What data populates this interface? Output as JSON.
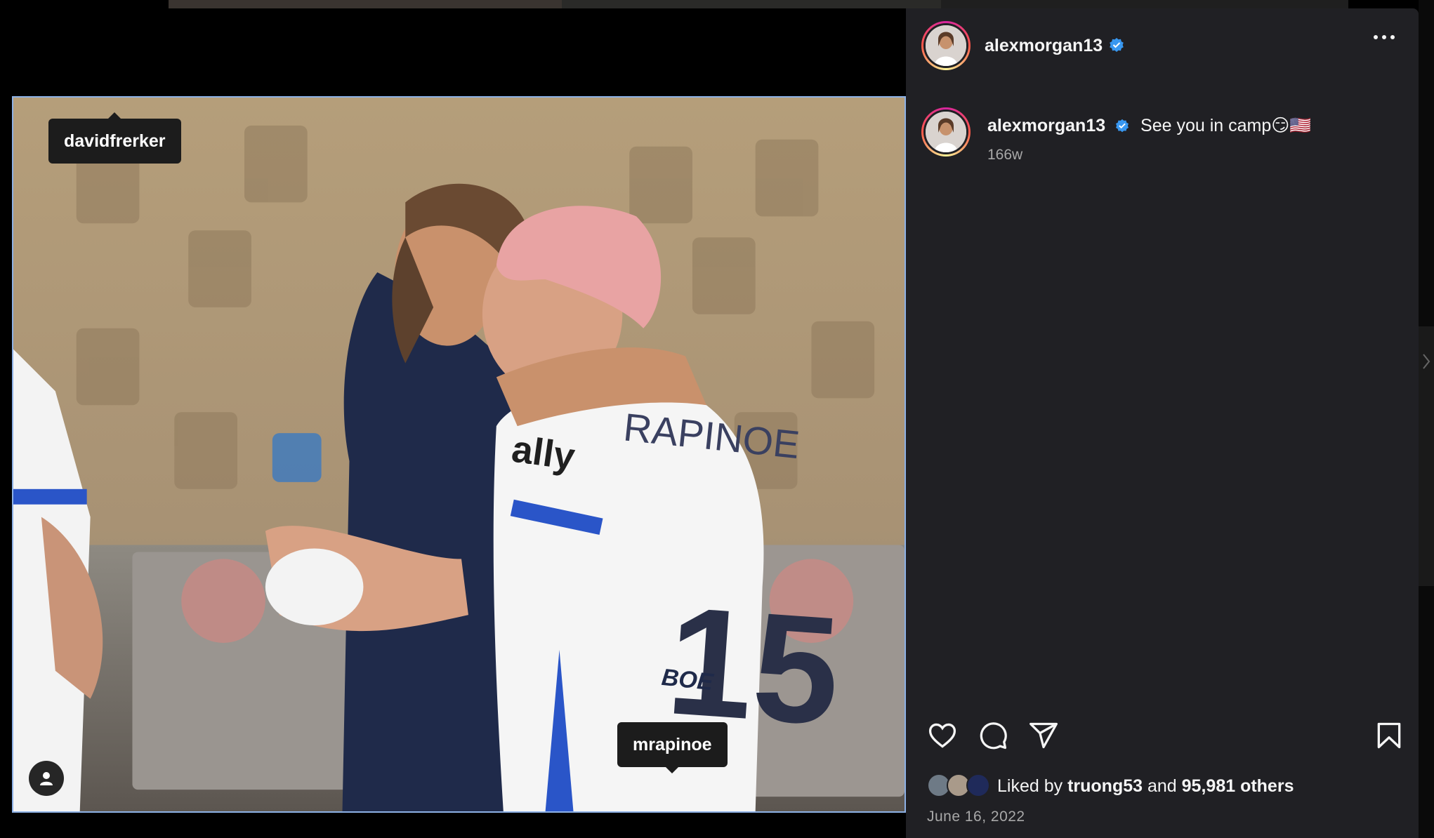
{
  "post": {
    "username": "alexmorgan13",
    "caption_text": "See you in camp😏🇺🇸",
    "age": "166w",
    "liked_prefix": "Liked by",
    "liked_user": "truong53",
    "liked_and": "and",
    "liked_others": "95,981 others",
    "date": "June 16, 2022"
  },
  "photo": {
    "tags": [
      "davidfrerker",
      "mrapinoe"
    ],
    "jersey_name": "RAPINOE",
    "jersey_number": "15",
    "sponsor": "ally",
    "sponsor2": "BOE"
  },
  "icons": {
    "like": "heart-icon",
    "comment": "comment-icon",
    "share": "send-icon",
    "save": "bookmark-icon",
    "more": "more-icon",
    "verified": "verified-badge-icon",
    "user_tags": "person-icon"
  },
  "colors": {
    "panel_bg": "#202024",
    "verified_blue": "#3897f0",
    "muted_text": "#a8a8a8"
  }
}
